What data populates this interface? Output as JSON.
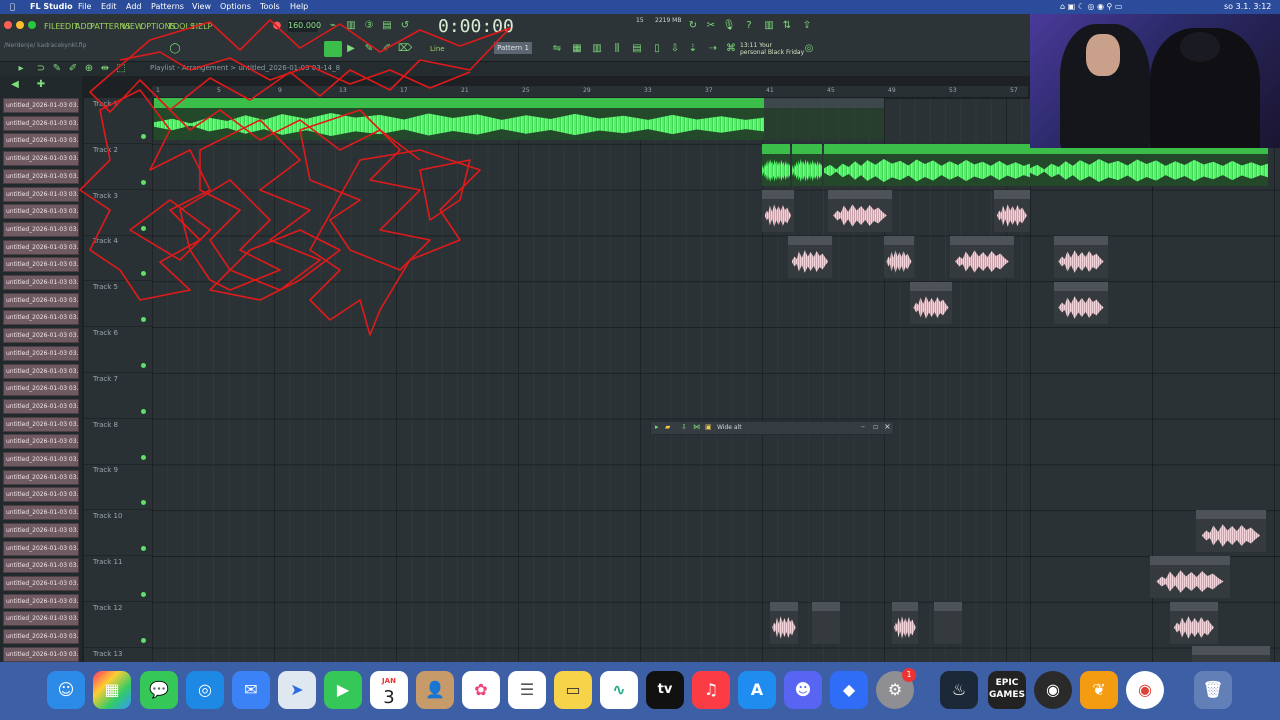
{
  "menubar": {
    "app": "FL Studio",
    "items": [
      "File",
      "Edit",
      "Add",
      "Patterns",
      "View",
      "Options",
      "Tools",
      "Help"
    ],
    "clock": "so 3.1.  3:12"
  },
  "fl": {
    "menu": [
      "FILE",
      "EDIT",
      "ADD",
      "PATTERNS",
      "VIEW",
      "OPTIONS",
      "TOOLS",
      "HELP"
    ],
    "bpm": "160.000",
    "time": "0:00:00",
    "cpu": "15",
    "ram": "2219 MB",
    "file_path": "/Nerdenje/ kadracekynkl.flp",
    "pattern": "Pattern 1",
    "hint_line1": "13:11  Your",
    "hint_line2": "personal Black Friday",
    "playlist_title": "Playlist - Arrangement > untitled_2026-01-03 03-14_8"
  },
  "browser": {
    "items": [
      "untitled_2026-01-03 03..",
      "untitled_2026-01-03 03..",
      "untitled_2026-01-03 03..",
      "untitled_2026-01-03 03..",
      "untitled_2026-01-03 03..",
      "untitled_2026-01-03 03..",
      "untitled_2026-01-03 03..",
      "untitled_2026-01-03 03..",
      "untitled_2026-01-03 03..",
      "untitled_2026-01-03 03..",
      "untitled_2026-01-03 03..",
      "untitled_2026-01-03 03..",
      "untitled_2026-01-03 03..",
      "untitled_2026-01-03 03..",
      "untitled_2026-01-03 03..",
      "untitled_2026-01-03 03..",
      "untitled_2026-01-03 03..",
      "untitled_2026-01-03 03..",
      "untitled_2026-01-03 03..",
      "untitled_2026-01-03 03..",
      "untitled_2026-01-03 03..",
      "untitled_2026-01-03 03..",
      "untitled_2026-01-03 03..",
      "untitled_2026-01-03 03..",
      "untitled_2026-01-03 03..",
      "untitled_2026-01-03 03..",
      "untitled_2026-01-03 03..",
      "untitled_2026-01-03 03..",
      "untitled_2026-01-03 03..",
      "untitled_2026-01-03 03..",
      "untitled_2026-01-03 03..",
      "untitled_2026-01-03 03.."
    ]
  },
  "tracks": [
    "Track 1",
    "Track 2",
    "Track 3",
    "Track 4",
    "Track 5",
    "Track 6",
    "Track 7",
    "Track 8",
    "Track 9",
    "Track 10",
    "Track 11",
    "Track 12",
    "Track 13"
  ],
  "ruler": [
    "1",
    "5",
    "9",
    "13",
    "17",
    "21",
    "25",
    "29",
    "33",
    "37",
    "41",
    "45",
    "49",
    "53",
    "57"
  ],
  "clips": {
    "kadr1": "kadrtrack",
    "kadr2": "kadrtrack",
    "kadr3": "k..ck",
    "kadr4": "k..ck",
    "kadr5": "kadrtrack",
    "u1": "untit..8",
    "u2": "untitled_..50-02_8",
    "u3": "untitled_202..01-51-56_8",
    "u4": "untitl..46_8",
    "u5": "unti..8",
    "u6": "untitl.._50-02_8",
    "u7": "untitl..3-31_8",
    "u8": "untitl..46_8",
    "u9": "untitle..2-29_8",
    "u10": "untitled_..-00-24_8",
    "u11": "untitled_20..02-59-56_8",
    "u12": "un..8",
    "u13": "unt..8",
    "u14": "unt..8",
    "u15": "unt..8",
    "u16": "unti..8",
    "u17": "untitled_..09-14_8"
  },
  "float_panel": {
    "title": "Wide alt"
  },
  "dock": {
    "calendar_month": "JAN",
    "calendar_day": "3",
    "epic": "EPIC GAMES",
    "tv": "tv",
    "badge": "1"
  },
  "colors": {
    "accent_green": "#3bbf4a",
    "clip_pink": "#f2d4da",
    "scribble_red": "#e01a1a"
  }
}
